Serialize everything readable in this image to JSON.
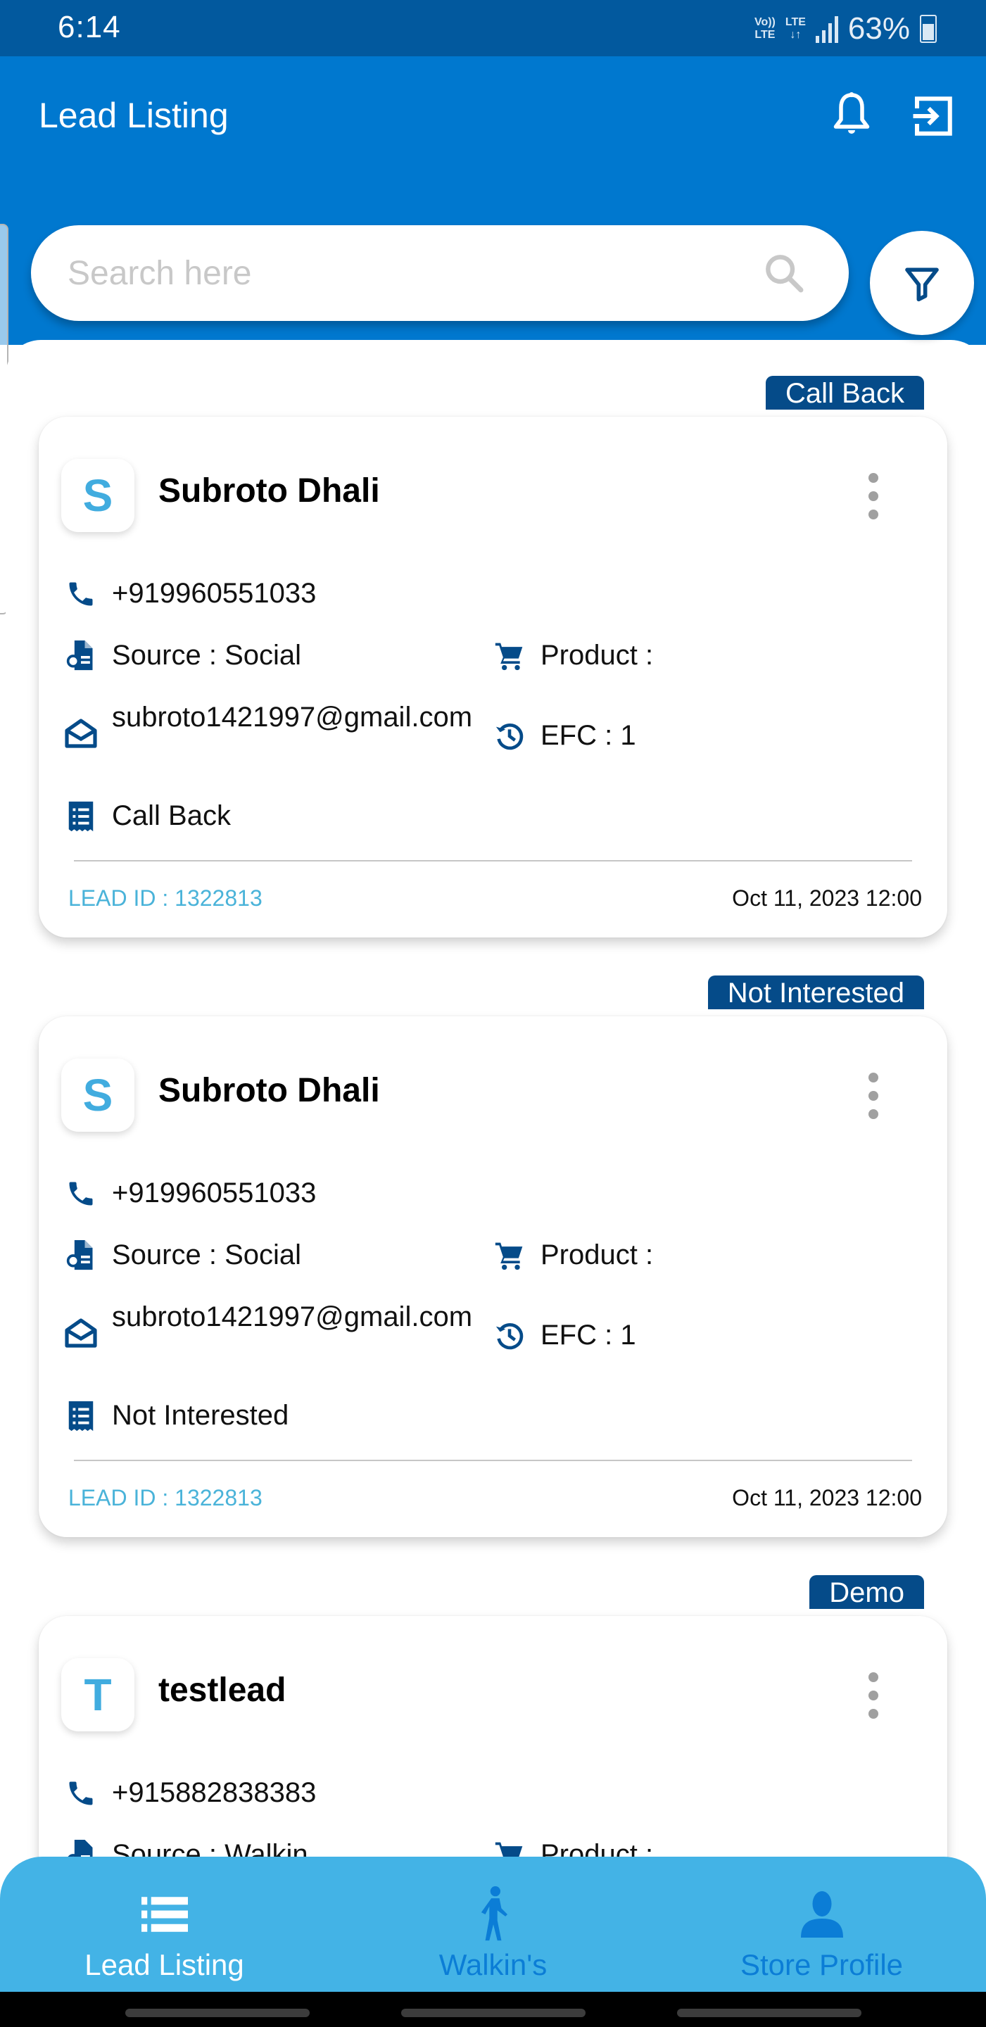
{
  "status_bar": {
    "time": "6:14",
    "volte_label": "Vo))\nLTE",
    "network_label": "LTE",
    "battery_percent": "63%",
    "battery_level": 0.63
  },
  "header": {
    "title": "Lead Listing",
    "icons": [
      "bell-icon",
      "logout-icon"
    ]
  },
  "search": {
    "placeholder": "Search here",
    "value": ""
  },
  "colors": {
    "status_bar": "#02599e",
    "header": "#0078cf",
    "tag": "#054b89",
    "icon": "#054b89",
    "avatar_letter": "#41acdf",
    "lead_id": "#4ab3d9",
    "bottom_nav": "#43b3e6",
    "nav_inactive": "#0b7dd6"
  },
  "leads": [
    {
      "status_tag": "Call Back",
      "initial": "S",
      "name": "Subroto Dhali",
      "phone": "+919960551033",
      "source": "Source : Social",
      "product": "Product :",
      "email": "subroto1421997@gmail.com",
      "efc": "EFC : 1",
      "status": "Call Back",
      "lead_id": "LEAD ID : 1322813",
      "date": "Oct 11, 2023 12:00"
    },
    {
      "status_tag": "Not Interested",
      "initial": "S",
      "name": "Subroto Dhali",
      "phone": "+919960551033",
      "source": "Source : Social",
      "product": "Product :",
      "email": "subroto1421997@gmail.com",
      "efc": "EFC : 1",
      "status": "Not Interested",
      "lead_id": "LEAD ID : 1322813",
      "date": "Oct 11, 2023 12:00"
    },
    {
      "status_tag": "Demo",
      "initial": "T",
      "name": "testlead",
      "phone": "+915882838383",
      "source": "Source : Walkin",
      "product": "Product :"
    }
  ],
  "bottom_nav": {
    "items": [
      {
        "label": "Lead Listing",
        "icon": "list-icon",
        "active": true
      },
      {
        "label": "Walkin's",
        "icon": "walking-person-icon",
        "active": false
      },
      {
        "label": "Store Profile",
        "icon": "person-icon",
        "active": false
      }
    ]
  }
}
